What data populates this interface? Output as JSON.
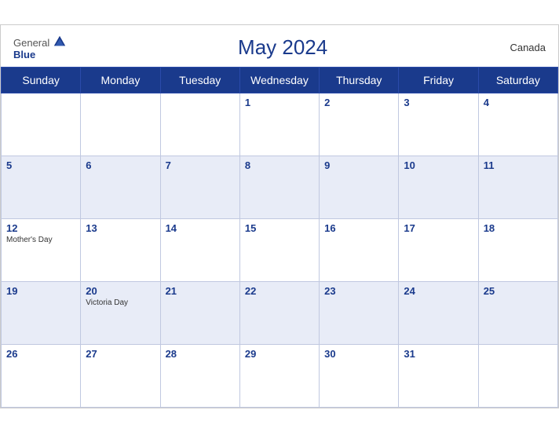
{
  "header": {
    "logo_general": "General",
    "logo_blue": "Blue",
    "title": "May 2024",
    "country": "Canada"
  },
  "weekdays": [
    "Sunday",
    "Monday",
    "Tuesday",
    "Wednesday",
    "Thursday",
    "Friday",
    "Saturday"
  ],
  "rows": [
    [
      {
        "day": "",
        "holiday": ""
      },
      {
        "day": "",
        "holiday": ""
      },
      {
        "day": "",
        "holiday": ""
      },
      {
        "day": "1",
        "holiday": ""
      },
      {
        "day": "2",
        "holiday": ""
      },
      {
        "day": "3",
        "holiday": ""
      },
      {
        "day": "4",
        "holiday": ""
      }
    ],
    [
      {
        "day": "5",
        "holiday": ""
      },
      {
        "day": "6",
        "holiday": ""
      },
      {
        "day": "7",
        "holiday": ""
      },
      {
        "day": "8",
        "holiday": ""
      },
      {
        "day": "9",
        "holiday": ""
      },
      {
        "day": "10",
        "holiday": ""
      },
      {
        "day": "11",
        "holiday": ""
      }
    ],
    [
      {
        "day": "12",
        "holiday": "Mother's Day"
      },
      {
        "day": "13",
        "holiday": ""
      },
      {
        "day": "14",
        "holiday": ""
      },
      {
        "day": "15",
        "holiday": ""
      },
      {
        "day": "16",
        "holiday": ""
      },
      {
        "day": "17",
        "holiday": ""
      },
      {
        "day": "18",
        "holiday": ""
      }
    ],
    [
      {
        "day": "19",
        "holiday": ""
      },
      {
        "day": "20",
        "holiday": "Victoria Day"
      },
      {
        "day": "21",
        "holiday": ""
      },
      {
        "day": "22",
        "holiday": ""
      },
      {
        "day": "23",
        "holiday": ""
      },
      {
        "day": "24",
        "holiday": ""
      },
      {
        "day": "25",
        "holiday": ""
      }
    ],
    [
      {
        "day": "26",
        "holiday": ""
      },
      {
        "day": "27",
        "holiday": ""
      },
      {
        "day": "28",
        "holiday": ""
      },
      {
        "day": "29",
        "holiday": ""
      },
      {
        "day": "30",
        "holiday": ""
      },
      {
        "day": "31",
        "holiday": ""
      },
      {
        "day": "",
        "holiday": ""
      }
    ]
  ],
  "row_shading": [
    "white",
    "shaded",
    "white",
    "shaded",
    "white"
  ]
}
